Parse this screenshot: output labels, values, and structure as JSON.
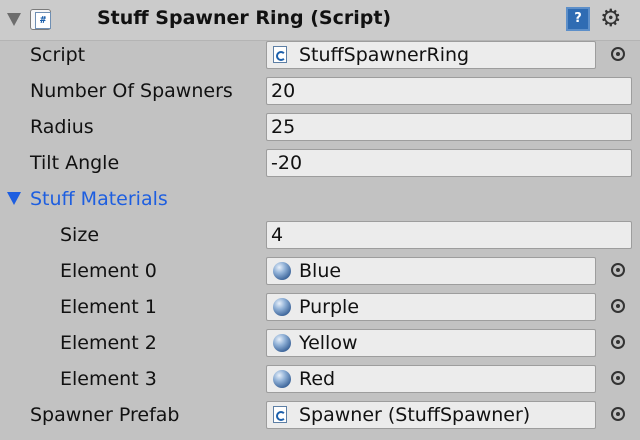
{
  "component": {
    "title": "Stuff Spawner Ring (Script)"
  },
  "fields": {
    "script": {
      "label": "Script",
      "value": "StuffSpawnerRing"
    },
    "number_of_spawners": {
      "label": "Number Of Spawners",
      "value": "20"
    },
    "radius": {
      "label": "Radius",
      "value": "25"
    },
    "tilt_angle": {
      "label": "Tilt Angle",
      "value": "-20"
    },
    "spawner_prefab": {
      "label": "Spawner Prefab",
      "value": "Spawner (StuffSpawner)"
    }
  },
  "stuff_materials": {
    "label": "Stuff Materials",
    "size_label": "Size",
    "size_value": "4",
    "elements": [
      {
        "label": "Element 0",
        "value": "Blue"
      },
      {
        "label": "Element 1",
        "value": "Purple"
      },
      {
        "label": "Element 2",
        "value": "Yellow"
      },
      {
        "label": "Element 3",
        "value": "Red"
      }
    ]
  },
  "icons": {
    "fold": "triangle-down",
    "enabled_checkbox": "checkbox",
    "script_type": "csharp-script",
    "help": "book-help",
    "settings": "gear",
    "object_picker": "target-circle",
    "material": "sphere"
  },
  "colors": {
    "panel_bg": "#c2c2c2",
    "field_bg": "#ececec",
    "foldout_accent": "#1d5ee0"
  }
}
